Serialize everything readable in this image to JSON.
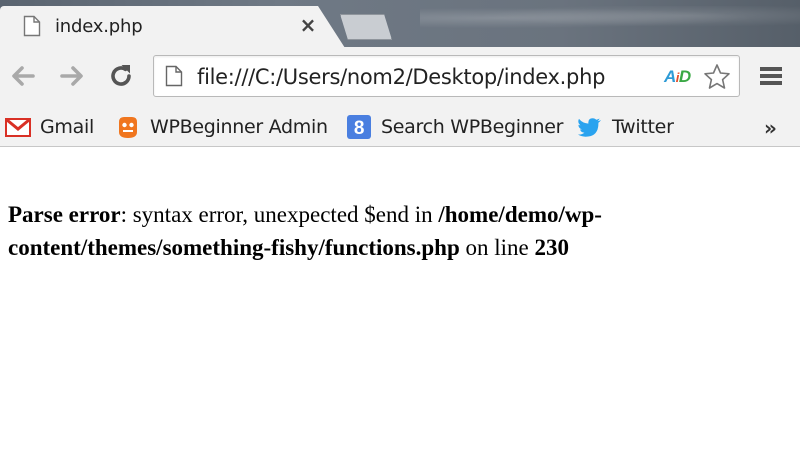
{
  "tab": {
    "title": "index.php",
    "close_glyph": "×",
    "favicon": "page-icon"
  },
  "toolbar": {
    "back_icon": "back-arrow-icon",
    "forward_icon": "forward-arrow-icon",
    "reload_icon": "reload-icon",
    "url": "file:///C:/Users/nom2/Desktop/index.php",
    "extension_badge": {
      "a": "A",
      "i": "i",
      "d": "D"
    },
    "star_icon": "star-icon",
    "menu_icon": "hamburger-menu-icon"
  },
  "bookmarks": {
    "items": [
      {
        "label": "Gmail",
        "icon": "gmail-icon"
      },
      {
        "label": "WPBeginner Admin",
        "icon": "wpbeginner-icon"
      },
      {
        "label": "Search WPBeginner",
        "icon": "google-search-icon"
      },
      {
        "label": "Twitter",
        "icon": "twitter-icon"
      }
    ],
    "more": "»"
  },
  "error": {
    "label": "Parse error",
    "message": ": syntax error, unexpected $end in ",
    "path": "/home/demo/wp-content/themes/something-fishy/functions.php",
    "on_line": " on line ",
    "line": "230"
  },
  "colors": {
    "ext_a": "#2e9bd6",
    "ext_i": "#e54b2a",
    "ext_d": "#3aa845",
    "gmail_red": "#d93025",
    "wpbeginner_orange": "#f0761f",
    "google_blue": "#4a7fe0",
    "twitter_blue": "#2aa3ef"
  }
}
